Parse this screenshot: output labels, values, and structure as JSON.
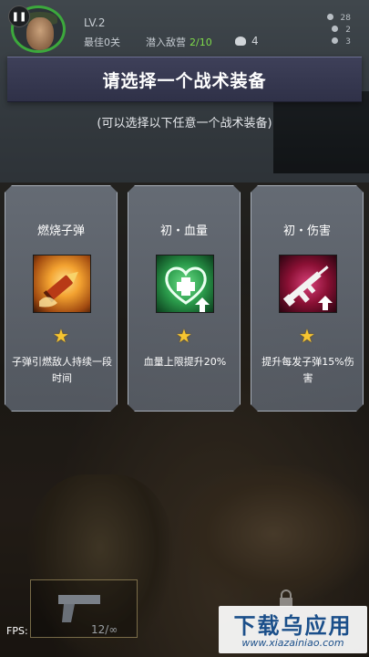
{
  "hud": {
    "pause_icon": "pause-icon",
    "level": "LV.2",
    "best_stage": "最佳0关",
    "infiltration_label": "潜入敌营",
    "infiltration_count": "2/10",
    "kills": "4",
    "stat_1": "28",
    "stat_2": "2",
    "stat_3": "3"
  },
  "dialog": {
    "title": "请选择一个战术装备",
    "subtitle": "(可以选择以下任意一个战术装备)",
    "cards": [
      {
        "name": "燃烧子弹",
        "icon": "incendiary-bullet-icon",
        "stars": "★",
        "desc": "子弹引燃敌人持续一段时间"
      },
      {
        "name": "初・血量",
        "icon": "health-up-icon",
        "stars": "★",
        "desc": "血量上限提升20%"
      },
      {
        "name": "初・伤害",
        "icon": "damage-up-icon",
        "stars": "★",
        "desc": "提升每发子弹15%伤害"
      }
    ]
  },
  "bottom": {
    "ammo": "12/∞",
    "fps_label": "FPS:",
    "watermark_title": "下载乌应用",
    "watermark_url": "www.xiazainiao.com"
  },
  "colors": {
    "banner": "#3e4059",
    "star": "#f6c531",
    "infil_count": "#7fdc4a"
  }
}
